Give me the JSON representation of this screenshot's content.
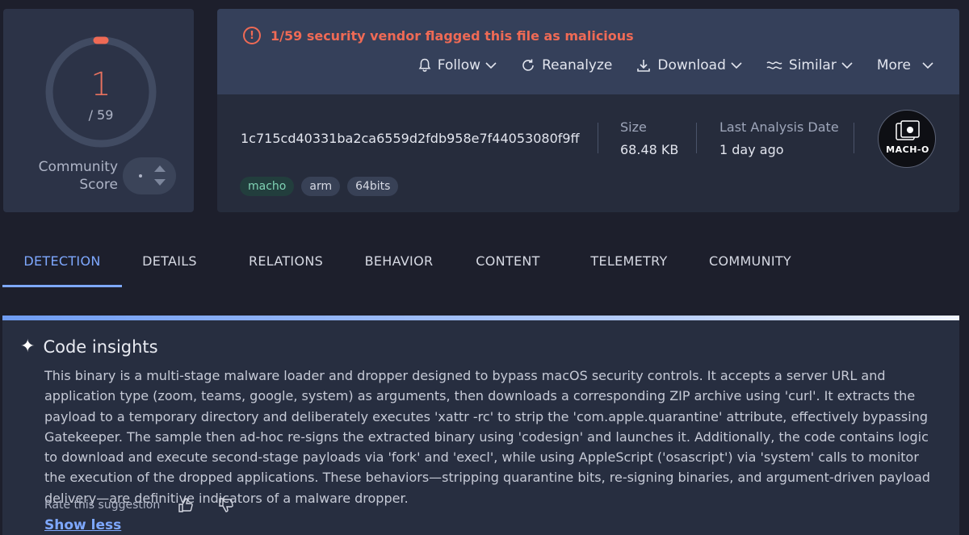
{
  "score": {
    "detections": "1",
    "total": "/ 59",
    "community_label": "Community\nScore",
    "detection_fraction": 0.017
  },
  "file": {
    "alert": "1/59 security vendor flagged this file as malicious",
    "actions": {
      "follow": "Follow",
      "reanalyze": "Reanalyze",
      "download": "Download",
      "similar": "Similar",
      "more": "More"
    },
    "hash": "1c715cd40331ba2ca6559d2fdb958e7f44053080f9ff…",
    "size_label": "Size",
    "size_value": "68.48 KB",
    "last_analysis_label": "Last Analysis Date",
    "last_analysis_value": "1 day ago",
    "tags": [
      "macho",
      "arm",
      "64bits"
    ],
    "filetype_label": "MACH-O"
  },
  "tabs": [
    "DETECTION",
    "DETAILS",
    "RELATIONS",
    "BEHAVIOR",
    "CONTENT",
    "TELEMETRY",
    "COMMUNITY"
  ],
  "insights": {
    "title": "Code insights",
    "body": "This binary is a multi-stage malware loader and dropper designed to bypass macOS security controls. It accepts a server URL and application type (zoom, teams, google, system) as arguments, then downloads a corresponding ZIP archive using 'curl'. It extracts the payload to a temporary directory and deliberately executes 'xattr -rc' to strip the 'com.apple.quarantine' attribute, effectively bypassing Gatekeeper. The sample then ad-hoc re-signs the extracted binary using 'codesign' and launches it. Additionally, the code contains logic to download and execute second-stage payloads via 'fork' and 'execl', while using AppleScript ('osascript') via 'system' calls to monitor the execution of the dropped applications. These behaviors—stripping quarantine bits, re-signing binaries, and argument-driven payload delivery—are definitive indicators of a malware dropper.",
    "rate_label": "Rate this suggestion",
    "show_less": "Show less"
  },
  "colors": {
    "malicious": "#ef6a55",
    "accent": "#7ea8ff",
    "background": "#1d1f2c"
  }
}
